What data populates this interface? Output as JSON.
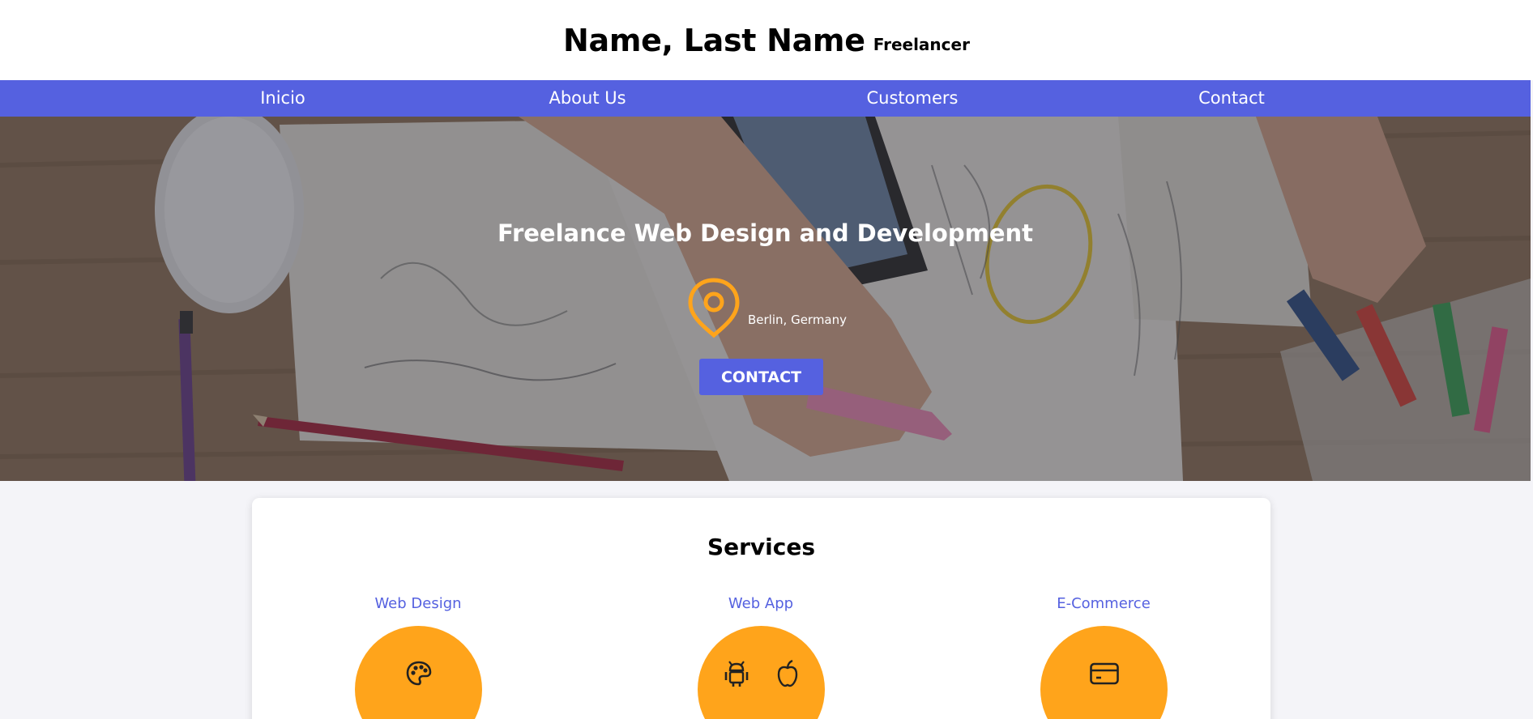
{
  "header": {
    "name": "Name, Last Name",
    "subtitle": "Freelancer"
  },
  "nav": {
    "items": [
      {
        "label": "Inicio"
      },
      {
        "label": "About Us"
      },
      {
        "label": "Customers"
      },
      {
        "label": "Contact"
      }
    ]
  },
  "hero": {
    "title": "Freelance Web Design and Development",
    "location_icon": "map-pin-icon",
    "location": "Berlin, Germany",
    "contact_button": "CONTACT"
  },
  "services": {
    "title": "Services",
    "items": [
      {
        "label": "Web Design",
        "icons": [
          "palette-icon"
        ]
      },
      {
        "label": "Web App",
        "icons": [
          "android-icon",
          "apple-icon"
        ]
      },
      {
        "label": "E-Commerce",
        "icons": [
          "credit-card-icon"
        ]
      }
    ]
  },
  "colors": {
    "accent": "#5561e0",
    "highlight": "#ffa41b",
    "header_bg": "#ffffff",
    "page_bg": "#f4f4f8"
  }
}
